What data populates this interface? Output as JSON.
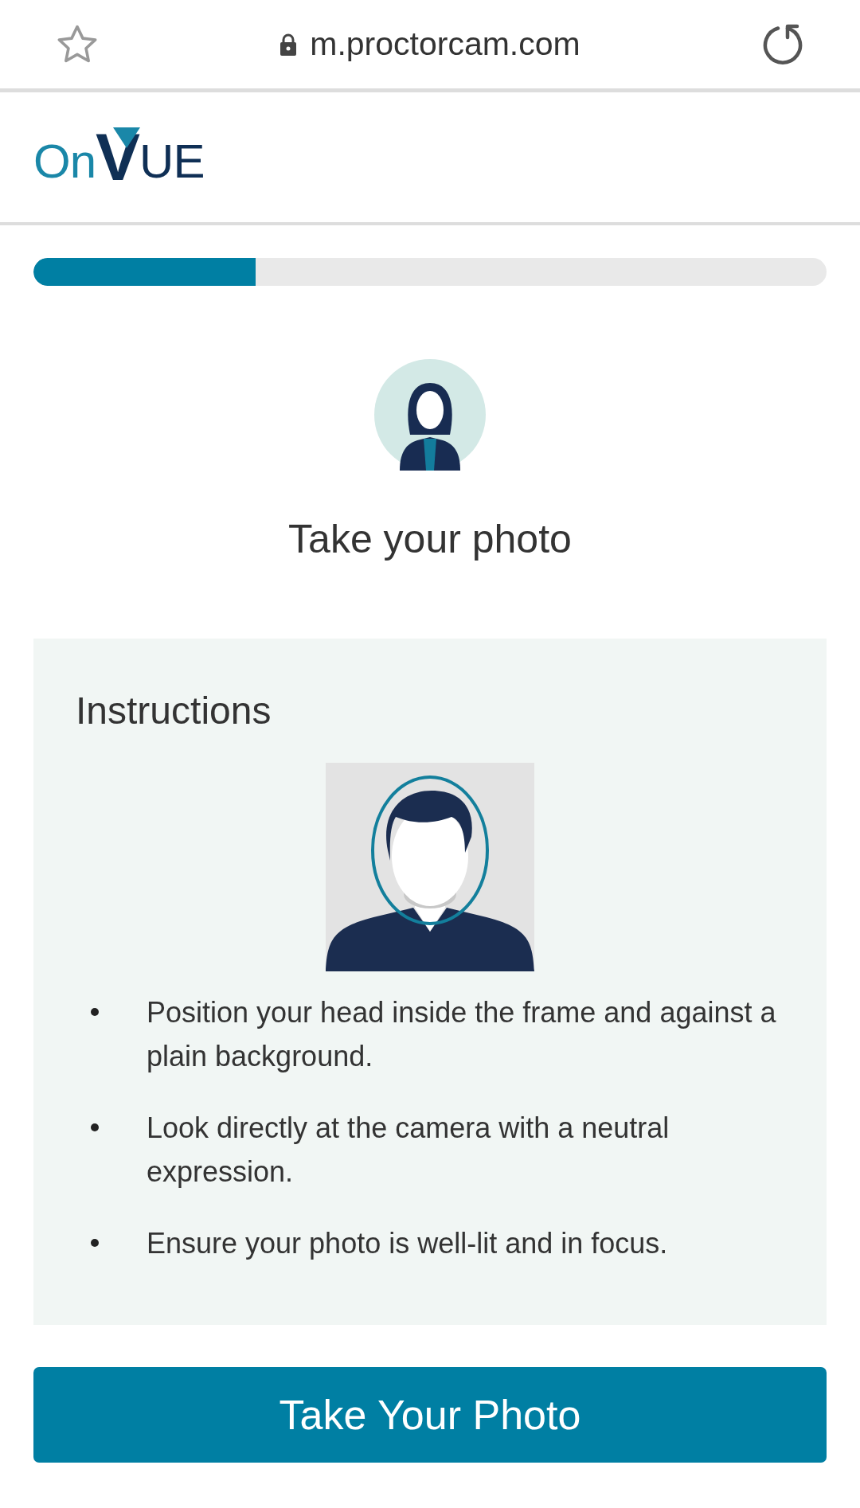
{
  "browser_bar": {
    "bookmarked": false,
    "secure": true,
    "url": "m.proctorcam.com"
  },
  "logo": {
    "parts": [
      {
        "text": "On",
        "color": "#1a87a8"
      },
      {
        "text": "V",
        "color": "#0f2f55"
      },
      {
        "text": "UE",
        "color": "#0f2f55"
      }
    ]
  },
  "progress": {
    "level": 0.28
  },
  "heading": "Take your photo",
  "instructions": {
    "title": "Instructions",
    "items": [
      "Position your head inside the frame and against a plain background.",
      "Look directly at the camera with a neutral expression.",
      "Ensure your photo is well-lit and in focus."
    ]
  },
  "button": {
    "label": "Take Your Photo"
  }
}
